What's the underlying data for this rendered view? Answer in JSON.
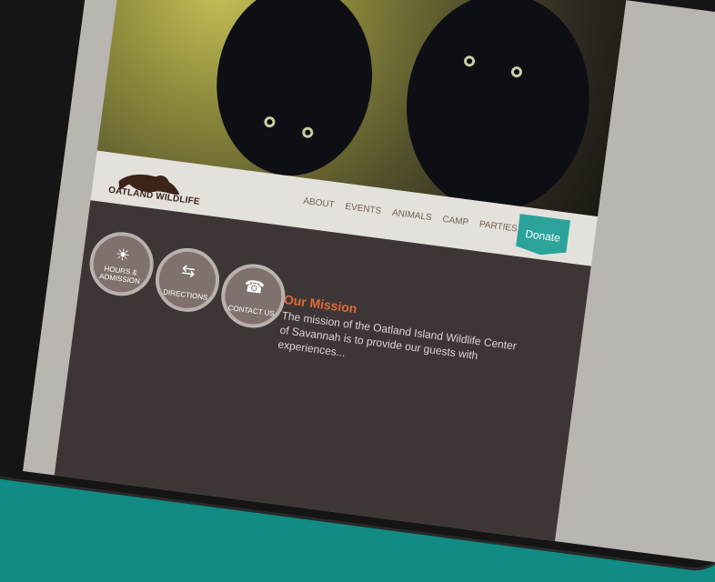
{
  "nav": [
    "ABOUT",
    "EVENTS",
    "ANIMALS",
    "CAMP",
    "PARTIES"
  ],
  "logo_text": "OATLAND WILDLIFE",
  "donate": "Donate",
  "features": [
    {
      "label": "HOURS & ADMISSION",
      "icon": "sun-icon"
    },
    {
      "label": "DIRECTIONS",
      "icon": "signpost-icon"
    },
    {
      "label": "CONTACT US",
      "icon": "phone-icon"
    }
  ],
  "mission": {
    "title": "Our Mission",
    "text": "The mission of the Oatland Island Wildlife Center of Savannah is to provide our guests with experiences..."
  },
  "colors": {
    "accent": "#2ba39b",
    "mission_title": "#e06b36",
    "background": "#118b84"
  }
}
